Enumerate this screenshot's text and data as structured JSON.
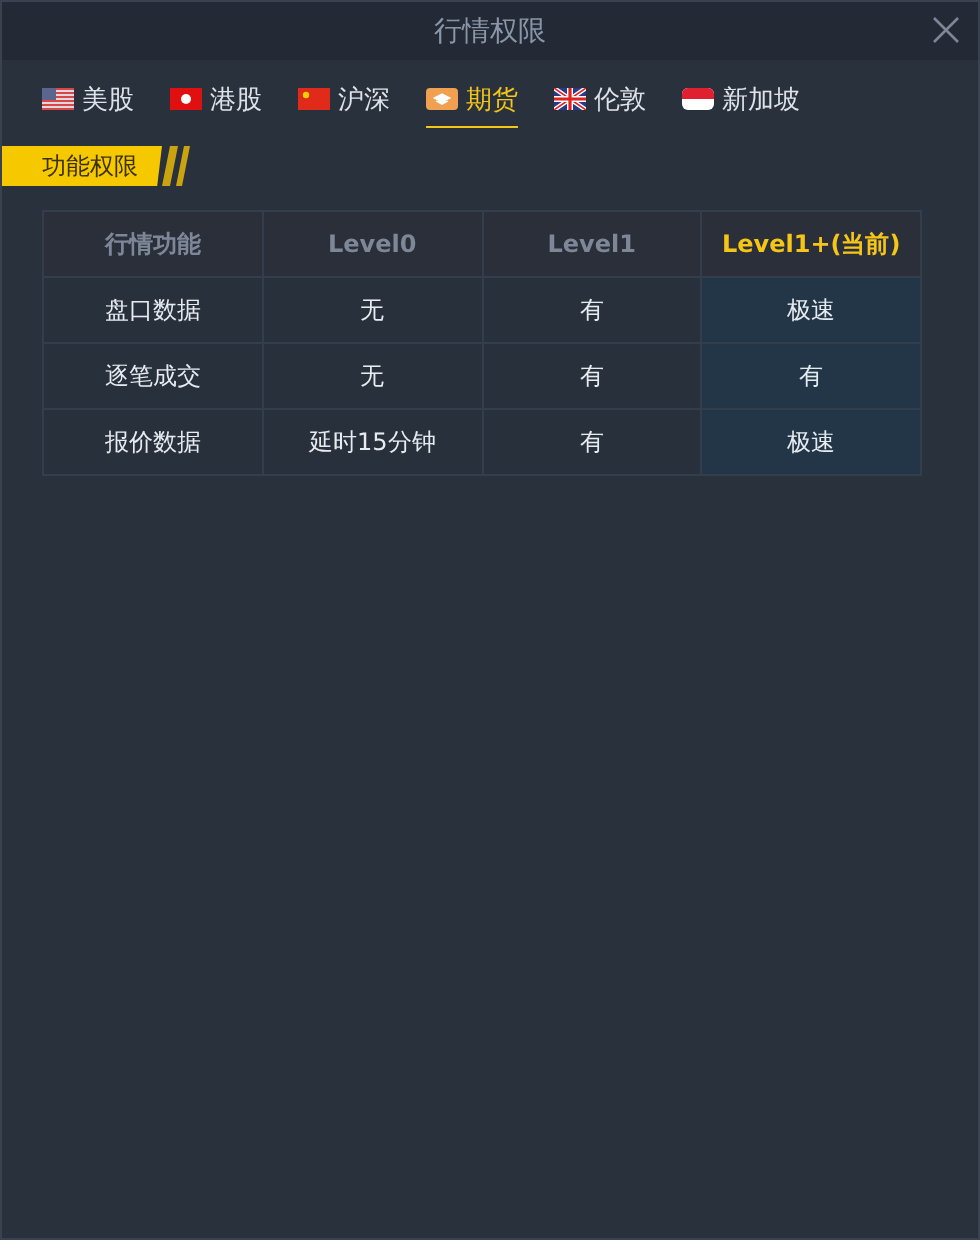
{
  "window": {
    "title": "行情权限"
  },
  "tabs": [
    {
      "label": "美股",
      "selected": false
    },
    {
      "label": "港股",
      "selected": false
    },
    {
      "label": "沪深",
      "selected": false
    },
    {
      "label": "期货",
      "selected": true
    },
    {
      "label": "伦敦",
      "selected": false
    },
    {
      "label": "新加坡",
      "selected": false
    }
  ],
  "section": {
    "title": "功能权限"
  },
  "table": {
    "columns": [
      {
        "label": "行情功能",
        "current": false
      },
      {
        "label": "Level0",
        "current": false
      },
      {
        "label": "Level1",
        "current": false
      },
      {
        "label": "Level1+(当前)",
        "current": true
      }
    ],
    "rows": [
      [
        "盘口数据",
        "无",
        "有",
        "极速"
      ],
      [
        "逐笔成交",
        "无",
        "有",
        "有"
      ],
      [
        "报价数据",
        "延时15分钟",
        "有",
        "极速"
      ]
    ]
  }
}
